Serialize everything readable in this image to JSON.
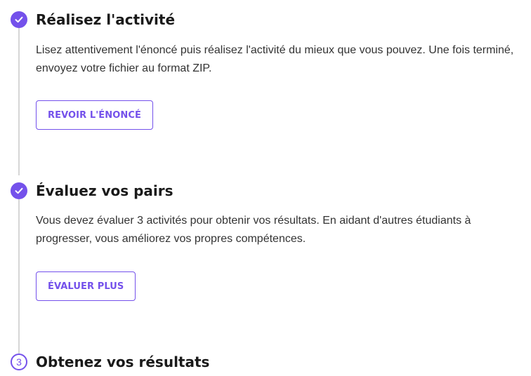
{
  "steps": [
    {
      "status": "done",
      "icon": "check-icon",
      "title": "Réalisez l'activité",
      "description": "Lisez attentivement l'énoncé puis réalisez l'activité du mieux que vous pouvez. Une fois terminé, envoyez votre fichier au format ZIP.",
      "button_label": "REVOIR L'ÉNONCÉ"
    },
    {
      "status": "done",
      "icon": "check-icon",
      "title": "Évaluez vos pairs",
      "description": "Vous devez évaluer 3 activités pour obtenir vos résultats. En aidant d'autres étudiants à progresser, vous améliorez vos propres compétences.",
      "button_label": "ÉVALUER PLUS"
    },
    {
      "status": "pending",
      "number": "3",
      "title": "Obtenez vos résultats"
    }
  ],
  "colors": {
    "accent": "#7451eb",
    "timeline": "#d6d6d6",
    "text": "#1a1a1a"
  }
}
